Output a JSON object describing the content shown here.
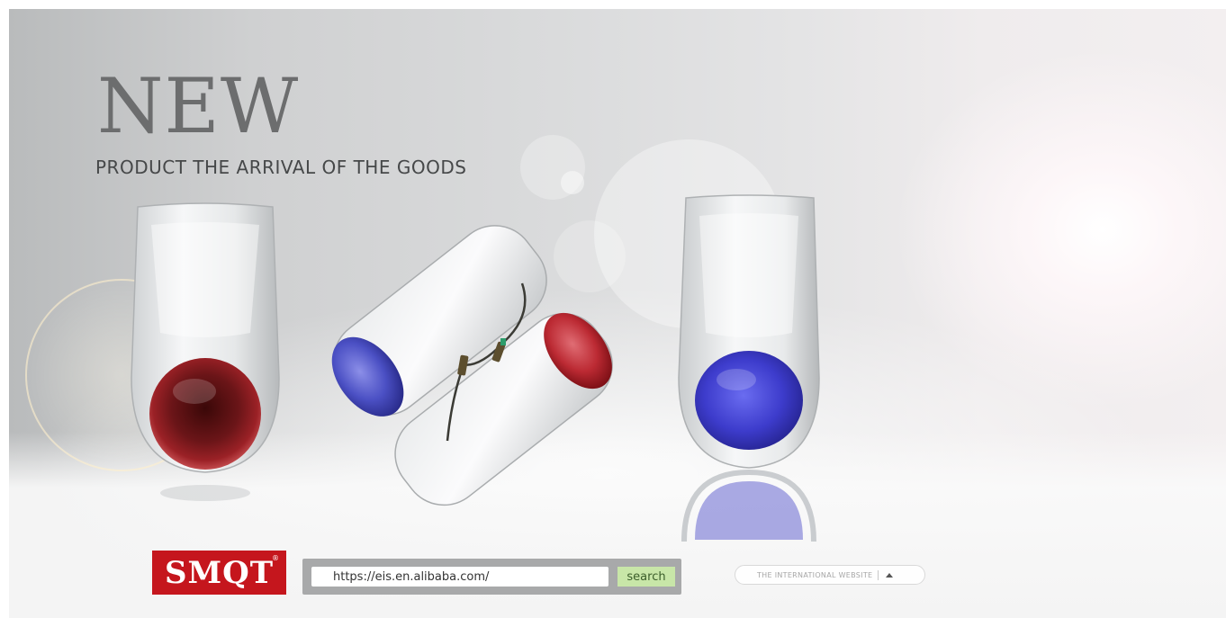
{
  "banner": {
    "headline": "NEW",
    "subheadline": "PRODUCT THE ARRIVAL OF THE GOODS"
  },
  "brand": {
    "logo_text": "SMQT",
    "registered_mark": "®",
    "color": "#c5161d"
  },
  "search": {
    "value": "https://eis.en.alibaba.com/",
    "button_label": "search",
    "button_color": "#c8e6a8"
  },
  "international": {
    "label": "THE INTERNATIONAL WEBSITE",
    "icon": "caret-up-icon"
  },
  "products": {
    "items": [
      {
        "name": "siren-red",
        "lens_color": "#9b1e22"
      },
      {
        "name": "siren-open-housing",
        "lens_colors": [
          "#4a4fc0",
          "#c8343c"
        ]
      },
      {
        "name": "siren-blue",
        "lens_color": "#3c3ad0"
      }
    ]
  }
}
